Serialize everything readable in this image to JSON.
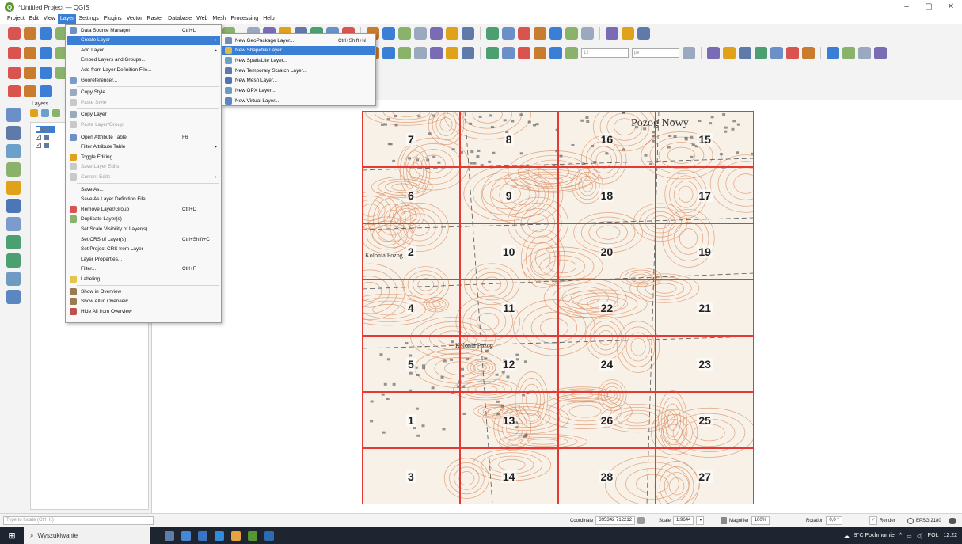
{
  "window": {
    "title": "*Untitled Project — QGIS",
    "minimize": "–",
    "maximize": "▢",
    "close": "✕"
  },
  "menubar": [
    "Project",
    "Edit",
    "View",
    "Layer",
    "Settings",
    "Plugins",
    "Vector",
    "Raster",
    "Database",
    "Web",
    "Mesh",
    "Processing",
    "Help"
  ],
  "active_menu": "Layer",
  "toolbar": {
    "scale_value": "12",
    "unit_value": "px"
  },
  "layers_panel": {
    "title": "Layers",
    "items": [
      {
        "name": "",
        "checked": true,
        "selected": true
      },
      {
        "name": "",
        "checked": true,
        "selected": false
      },
      {
        "name": "",
        "checked": true,
        "selected": false
      }
    ]
  },
  "layer_menu": [
    {
      "label": "Data Source Manager",
      "shortcut": "Ctrl+L",
      "icon_color": "#6b8fc7",
      "enabled": true
    },
    {
      "label": "Create Layer",
      "shortcut": "",
      "submenu": true,
      "highlighted": true,
      "enabled": true
    },
    {
      "label": "Add Layer",
      "shortcut": "",
      "submenu": true,
      "enabled": true
    },
    {
      "label": "Embed Layers and Groups...",
      "shortcut": "",
      "enabled": true
    },
    {
      "label": "Add from Layer Definition File...",
      "shortcut": "",
      "enabled": true
    },
    {
      "label": "Georeferencer...",
      "shortcut": "",
      "icon_color": "#7a9bcc",
      "enabled": true
    },
    {
      "label": "Copy Style",
      "shortcut": "",
      "icon_color": "#9aa9bd",
      "enabled": true,
      "sep_before": true
    },
    {
      "label": "Paste Style",
      "shortcut": "",
      "icon_color": "#c9c9c9",
      "enabled": false
    },
    {
      "label": "Copy Layer",
      "shortcut": "",
      "icon_color": "#9aa9bd",
      "enabled": true,
      "sep_before": true
    },
    {
      "label": "Paste Layer/Group",
      "shortcut": "",
      "icon_color": "#c9c9c9",
      "enabled": false
    },
    {
      "label": "Open Attribute Table",
      "shortcut": "F6",
      "icon_color": "#6b8fc7",
      "enabled": true,
      "sep_before": true
    },
    {
      "label": "Filter Attribute Table",
      "shortcut": "",
      "submenu": true,
      "enabled": true
    },
    {
      "label": "Toggle Editing",
      "shortcut": "",
      "icon_color": "#e0a21a",
      "enabled": true
    },
    {
      "label": "Save Layer Edits",
      "shortcut": "",
      "icon_color": "#c9c9c9",
      "enabled": false
    },
    {
      "label": "Current Edits",
      "shortcut": "",
      "submenu": true,
      "icon_color": "#c9c9c9",
      "enabled": false
    },
    {
      "label": "Save As...",
      "shortcut": "",
      "enabled": true,
      "sep_before": true
    },
    {
      "label": "Save As Layer Definition File...",
      "shortcut": "",
      "enabled": true
    },
    {
      "label": "Remove Layer/Group",
      "shortcut": "Ctrl+D",
      "icon_color": "#d9534f",
      "enabled": true
    },
    {
      "label": "Duplicate Layer(s)",
      "shortcut": "",
      "icon_color": "#8bb26b",
      "enabled": true
    },
    {
      "label": "Set Scale Visibility of Layer(s)",
      "shortcut": "",
      "enabled": true
    },
    {
      "label": "Set CRS of Layer(s)",
      "shortcut": "Ctrl+Shift+C",
      "enabled": true
    },
    {
      "label": "Set Project CRS from Layer",
      "shortcut": "",
      "enabled": true
    },
    {
      "label": "Layer Properties...",
      "shortcut": "",
      "enabled": true
    },
    {
      "label": "Filter...",
      "shortcut": "Ctrl+F",
      "enabled": true
    },
    {
      "label": "Labeling",
      "shortcut": "",
      "icon_color": "#e6c34a",
      "enabled": true
    },
    {
      "label": "Show in Overview",
      "shortcut": "",
      "icon_color": "#9a7b4f",
      "enabled": true,
      "sep_before": true
    },
    {
      "label": "Show All in Overview",
      "shortcut": "",
      "icon_color": "#9a7b4f",
      "enabled": true
    },
    {
      "label": "Hide All from Overview",
      "shortcut": "",
      "icon_color": "#c0504d",
      "enabled": true
    }
  ],
  "create_layer_submenu": [
    {
      "label": "New GeoPackage Layer...",
      "shortcut": "Ctrl+Shift+N",
      "icon_color": "#6d8fb8"
    },
    {
      "label": "New Shapefile Layer...",
      "shortcut": "",
      "icon_color": "#e2b84a",
      "highlighted": true
    },
    {
      "label": "New SpatiaLite Layer...",
      "shortcut": "",
      "icon_color": "#6aa0c9"
    },
    {
      "label": "New Temporary Scratch Layer...",
      "shortcut": "",
      "icon_color": "#5f7aa8"
    },
    {
      "label": "New Mesh Layer...",
      "shortcut": "",
      "icon_color": "#4c76b5"
    },
    {
      "label": "New GPX Layer...",
      "shortcut": "",
      "icon_color": "#6f9bc3"
    },
    {
      "label": "New Virtual Layer...",
      "shortcut": "",
      "icon_color": "#5b86bf"
    }
  ],
  "map": {
    "grid_color": "#e53935",
    "columns": 4,
    "rows": 7,
    "cell_labels": [
      [
        "7",
        "8",
        "16",
        "15"
      ],
      [
        "6",
        "9",
        "18",
        "17"
      ],
      [
        "2",
        "10",
        "20",
        "19"
      ],
      [
        "4",
        "11",
        "22",
        "21"
      ],
      [
        "5",
        "12",
        "24",
        "23"
      ],
      [
        "1",
        "13",
        "26",
        "25"
      ],
      [
        "3",
        "14",
        "28",
        "27"
      ]
    ],
    "place_labels": [
      {
        "text": "Pozog Nowy",
        "size": "large"
      },
      {
        "text": "Kolonia Pozog",
        "size": "small"
      },
      {
        "text": "Kolonia Pożog",
        "size": "small"
      }
    ]
  },
  "status_bar": {
    "locate_placeholder": "Type to locate (Ctrl+K)",
    "coordinate_label": "Coordinate",
    "coordinate_value": "395342 712212",
    "scale_label": "Scale",
    "scale_value": "1:9644",
    "magnifier_label": "Magnifier",
    "magnifier_value": "100%",
    "rotation_label": "Rotation",
    "rotation_value": "0,0 °",
    "render_label": "Render",
    "crs": "EPSG:2180"
  },
  "taskbar": {
    "search_text": "Wyszukiwanie",
    "weather": "9°C Pochmurnie",
    "language": "POL",
    "time": "12:22"
  }
}
